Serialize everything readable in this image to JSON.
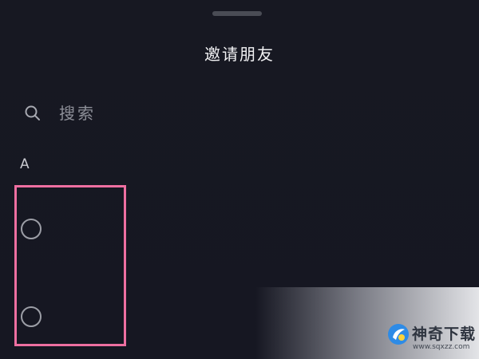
{
  "sheet": {
    "title": "邀请朋友"
  },
  "search": {
    "placeholder": "搜索",
    "icon": "search-icon"
  },
  "contacts": {
    "section_letter": "A",
    "items": [
      {
        "selected": false
      },
      {
        "selected": false
      }
    ]
  },
  "highlight": {
    "color": "#ee6fa1"
  },
  "watermark": {
    "brand": "神奇下载",
    "url": "www.sqxzz.com"
  }
}
